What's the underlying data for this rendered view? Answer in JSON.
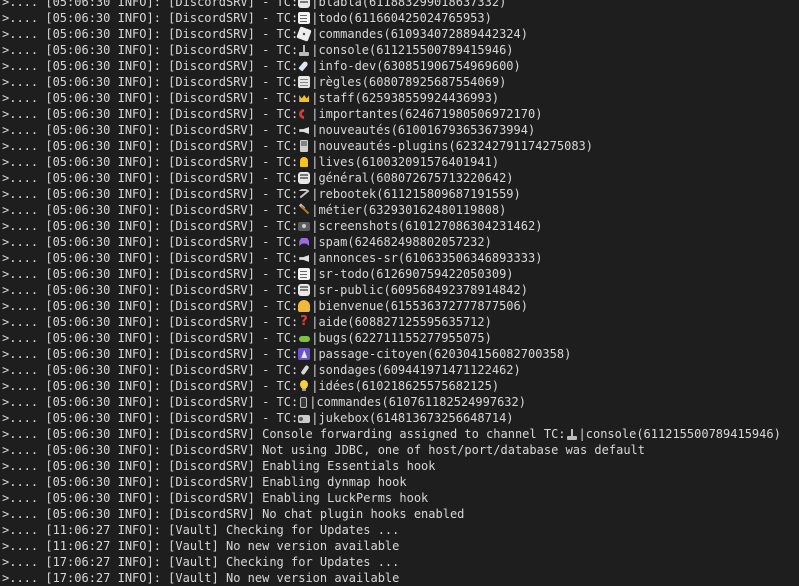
{
  "prompt": ">....",
  "lines": [
    {
      "text": "[05:06:30 INFO]: [DiscordSRV] - TC:",
      "icon": "speech-balloon-icon",
      "channel": "|blabla(611883299018637332)"
    },
    {
      "text": "[05:06:30 INFO]: [DiscordSRV] - TC:",
      "icon": "memo-icon",
      "channel": "|todo(611660425024765953)"
    },
    {
      "text": "[05:06:30 INFO]: [DiscordSRV] - TC:",
      "icon": "dice-icon",
      "channel": "|commandes(610934072889442324)"
    },
    {
      "text": "[05:06:30 INFO]: [DiscordSRV] - TC:",
      "icon": "joystick-icon",
      "channel": "|console(611215500789415946)"
    },
    {
      "text": "[05:06:30 INFO]: [DiscordSRV] - TC:",
      "icon": "rocket-icon",
      "channel": "|info-dev(630851906754969600)"
    },
    {
      "text": "[05:06:30 INFO]: [DiscordSRV] - TC:",
      "icon": "rules-icon",
      "channel": "|règles(608078925687554069)"
    },
    {
      "text": "[05:06:30 INFO]: [DiscordSRV] - TC:",
      "icon": "crown-icon",
      "channel": "|staff(625938559924436993)"
    },
    {
      "text": "[05:06:30 INFO]: [DiscordSRV] - TC:",
      "icon": "telephone-icon",
      "channel": "|importantes(624671980506972170)"
    },
    {
      "text": "[05:06:30 INFO]: [DiscordSRV] - TC:",
      "icon": "megaphone-icon",
      "channel": "|nouveautés(610016793653673994)"
    },
    {
      "text": "[05:06:30 INFO]: [DiscordSRV] - TC:",
      "icon": "pager-icon",
      "channel": "|nouveautés-plugins(623242791174275083)"
    },
    {
      "text": "[05:06:30 INFO]: [DiscordSRV] - TC:",
      "icon": "bell-icon",
      "channel": "|lives(610032091576401941)"
    },
    {
      "text": "[05:06:30 INFO]: [DiscordSRV] - TC:",
      "icon": "speech-balloon-icon",
      "channel": "|général(608072675713220642)"
    },
    {
      "text": "[05:06:30 INFO]: [DiscordSRV] - TC:",
      "icon": "pick-icon",
      "channel": "|rebootek(611215809687191559)"
    },
    {
      "text": "[05:06:30 INFO]: [DiscordSRV] - TC:",
      "icon": "hammer-icon",
      "channel": "|métier(632930162480119808)"
    },
    {
      "text": "[05:06:30 INFO]: [DiscordSRV] - TC:",
      "icon": "camera-icon",
      "channel": "|screenshots(610127086304231462)"
    },
    {
      "text": "[05:06:30 INFO]: [DiscordSRV] - TC:",
      "icon": "space-invader-icon",
      "channel": "|spam(624682498802057232)"
    },
    {
      "text": "[05:06:30 INFO]: [DiscordSRV] - TC:",
      "icon": "megaphone-icon",
      "channel": "|annonces-sr(610633506346893333)"
    },
    {
      "text": "[05:06:30 INFO]: [DiscordSRV] - TC:",
      "icon": "memo-icon",
      "channel": "|sr-todo(612690759422050309)"
    },
    {
      "text": "[05:06:30 INFO]: [DiscordSRV] - TC:",
      "icon": "speech-balloon-icon",
      "channel": "|sr-public(609568492378914842)"
    },
    {
      "text": "[05:06:30 INFO]: [DiscordSRV] - TC:",
      "icon": "waving-icon",
      "channel": "|bienvenue(615536372777877506)"
    },
    {
      "text": "[05:06:30 INFO]: [DiscordSRV] - TC:",
      "icon": "question-icon",
      "channel": "|aide(608827125595635712)"
    },
    {
      "text": "[05:06:30 INFO]: [DiscordSRV] - TC:",
      "icon": "bug-icon",
      "channel": "|bugs(622711155277955075)"
    },
    {
      "text": "[05:06:30 INFO]: [DiscordSRV] - TC:",
      "icon": "citizen-icon",
      "channel": "|passage-citoyen(620304156082700358)"
    },
    {
      "text": "[05:06:30 INFO]: [DiscordSRV] - TC:",
      "icon": "microphone-icon",
      "channel": "|sondages(609441971471122462)"
    },
    {
      "text": "[05:06:30 INFO]: [DiscordSRV] - TC:",
      "icon": "light-bulb-icon",
      "channel": "|idées(610218625575682125)"
    },
    {
      "text": "[05:06:30 INFO]: [DiscordSRV] - TC:",
      "icon": "mobile-phone-icon",
      "channel": "|commandes(610761182524997632)"
    },
    {
      "text": "[05:06:30 INFO]: [DiscordSRV] - TC:",
      "icon": "radio-icon",
      "channel": "|jukebox(614813673256648714)"
    },
    {
      "text": "[05:06:30 INFO]: [DiscordSRV] Console forwarding assigned to channel TC:",
      "icon": "joystick-icon",
      "channel": "|console(611215500789415946)"
    },
    {
      "text": "[05:06:30 INFO]: [DiscordSRV] Not using JDBC, one of host/port/database was default"
    },
    {
      "text": "[05:06:30 INFO]: [DiscordSRV] Enabling Essentials hook"
    },
    {
      "text": "[05:06:30 INFO]: [DiscordSRV] Enabling dynmap hook"
    },
    {
      "text": "[05:06:30 INFO]: [DiscordSRV] Enabling LuckPerms hook"
    },
    {
      "text": "[05:06:30 INFO]: [DiscordSRV] No chat plugin hooks enabled"
    },
    {
      "text": "[11:06:27 INFO]: [Vault] Checking for Updates ..."
    },
    {
      "text": "[11:06:27 INFO]: [Vault] No new version available"
    },
    {
      "text": "[17:06:27 INFO]: [Vault] Checking for Updates ..."
    },
    {
      "text": "[17:06:27 INFO]: [Vault] No new version available"
    }
  ]
}
